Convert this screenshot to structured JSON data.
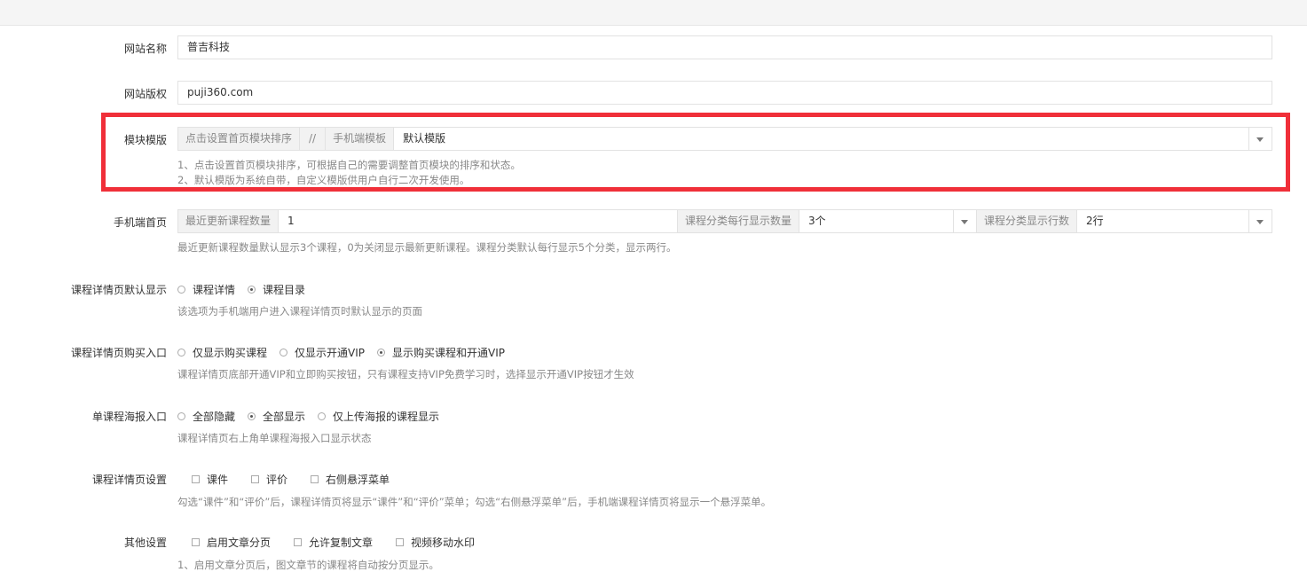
{
  "form": {
    "site_name": {
      "label": "网站名称",
      "value": "普吉科技"
    },
    "site_copyright": {
      "label": "网站版权",
      "value": "puji360.com"
    },
    "module_template": {
      "label": "模块模版",
      "addon_sort": "点击设置首页模块排序",
      "separator": "//",
      "addon_mobile": "手机端模板",
      "value": "默认模版",
      "help": [
        "1、点击设置首页模块排序，可根据自己的需要调整首页模块的排序和状态。",
        "2、默认模版为系统自带，自定义模版供用户自行二次开发使用。"
      ]
    },
    "mobile_home": {
      "label": "手机端首页",
      "recent_label": "最近更新课程数量",
      "recent_value": "1",
      "per_row_label": "课程分类每行显示数量",
      "per_row_value": "3个",
      "rows_label": "课程分类显示行数",
      "rows_value": "2行",
      "help": "最近更新课程数量默认显示3个课程，0为关闭显示最新更新课程。课程分类默认每行显示5个分类，显示两行。"
    },
    "detail_default": {
      "label": "课程详情页默认显示",
      "options": [
        "课程详情",
        "课程目录"
      ],
      "selected": 1,
      "help": "该选项为手机端用户进入课程详情页时默认显示的页面"
    },
    "detail_buy": {
      "label": "课程详情页购买入口",
      "options": [
        "仅显示购买课程",
        "仅显示开通VIP",
        "显示购买课程和开通VIP"
      ],
      "selected": 2,
      "help": "课程详情页底部开通VIP和立即购买按钮，只有课程支持VIP免费学习时，选择显示开通VIP按钮才生效"
    },
    "poster_entry": {
      "label": "单课程海报入口",
      "options": [
        "全部隐藏",
        "全部显示",
        "仅上传海报的课程显示"
      ],
      "selected": 1,
      "help": "课程详情页右上角单课程海报入口显示状态"
    },
    "detail_settings": {
      "label": "课程详情页设置",
      "options": [
        "课件",
        "评价",
        "右侧悬浮菜单"
      ],
      "help": "勾选“课件”和“评价”后，课程详情页将显示“课件”和“评价”菜单；勾选“右侧悬浮菜单”后，手机端课程详情页将显示一个悬浮菜单。"
    },
    "other_settings": {
      "label": "其他设置",
      "options": [
        "启用文章分页",
        "允许复制文章",
        "视频移动水印"
      ],
      "help": "1、启用文章分页后，图文章节的课程将自动按分页显示。"
    }
  },
  "colors": {
    "highlight_border": "#f02f39",
    "addon_bg": "#f2f2f2",
    "help_text": "#888888"
  }
}
